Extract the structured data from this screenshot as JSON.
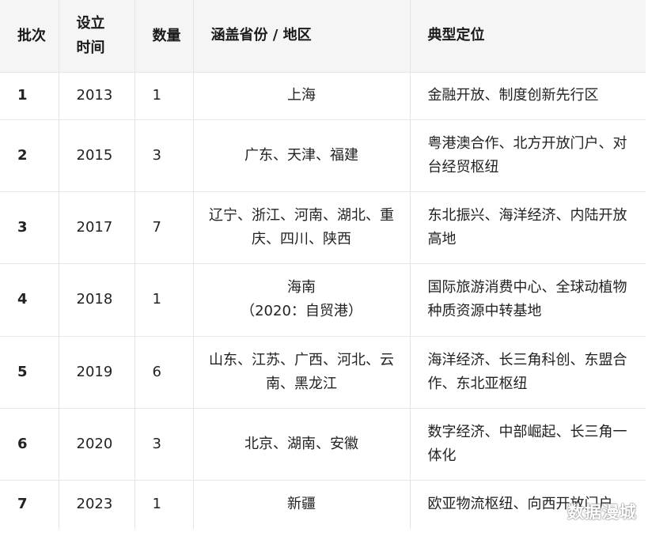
{
  "headers": {
    "batch": "批次",
    "time": "设立时间",
    "count": "数量",
    "provinces": "涵盖省份 / 地区",
    "positioning": "典型定位"
  },
  "rows": [
    {
      "batch": "1",
      "year": "2013",
      "count": "1",
      "provinces": "上海",
      "positioning": "金融开放、制度创新先行区"
    },
    {
      "batch": "2",
      "year": "2015",
      "count": "3",
      "provinces": "广东、天津、福建",
      "positioning": "粤港澳合作、北方开放门户、对台经贸枢纽"
    },
    {
      "batch": "3",
      "year": "2017",
      "count": "7",
      "provinces": "辽宁、浙江、河南、湖北、重庆、四川、陕西",
      "positioning": "东北振兴、海洋经济、内陆开放高地"
    },
    {
      "batch": "4",
      "year": "2018",
      "count": "1",
      "provinces": "海南",
      "provinces_note": "（2020：自贸港）",
      "positioning": "国际旅游消费中心、全球动植物种质资源中转基地"
    },
    {
      "batch": "5",
      "year": "2019",
      "count": "6",
      "provinces": "山东、江苏、广西、河北、云南、黑龙江",
      "positioning": "海洋经济、长三角科创、东盟合作、东北亚枢纽"
    },
    {
      "batch": "6",
      "year": "2020",
      "count": "3",
      "provinces": "北京、湖南、安徽",
      "positioning": "数字经济、中部崛起、长三角一体化"
    },
    {
      "batch": "7",
      "year": "2023",
      "count": "1",
      "provinces": "新疆",
      "positioning": "欧亚物流枢纽、向西开放门户"
    }
  ],
  "watermark": "数据漫城"
}
